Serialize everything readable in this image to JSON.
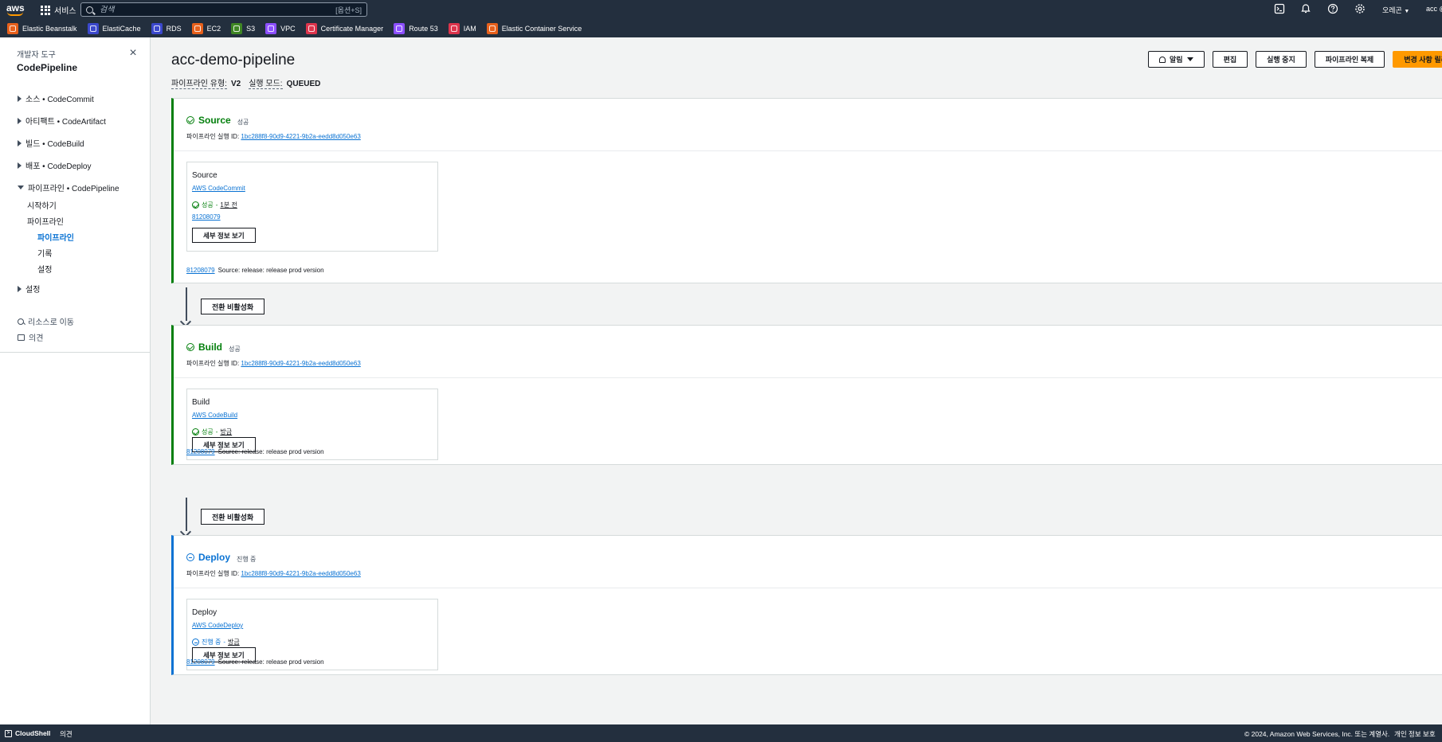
{
  "topnav": {
    "logo": "aws",
    "services": "서비스",
    "search_placeholder": "검색",
    "search_shortcut": "[옵션+S]",
    "region": "오레곤",
    "account": "acc @",
    "icons": [
      "cloudshell-icon",
      "bell-icon",
      "help-icon",
      "gear-icon"
    ]
  },
  "favorites": [
    {
      "label": "Elastic Beanstalk",
      "color": "#e7601b"
    },
    {
      "label": "ElastiCache",
      "color": "#3b48cc"
    },
    {
      "label": "RDS",
      "color": "#3b48cc"
    },
    {
      "label": "EC2",
      "color": "#e7601b"
    },
    {
      "label": "S3",
      "color": "#3f8624"
    },
    {
      "label": "VPC",
      "color": "#8c4fff"
    },
    {
      "label": "Certificate Manager",
      "color": "#dd344c"
    },
    {
      "label": "Route 53",
      "color": "#8c4fff"
    },
    {
      "label": "IAM",
      "color": "#dd344c"
    },
    {
      "label": "Elastic Container Service",
      "color": "#e7601b"
    }
  ],
  "sidebar": {
    "devtools": "개발자 도구",
    "title": "CodePipeline",
    "groups": [
      {
        "label": "소스 • CodeCommit",
        "expanded": false
      },
      {
        "label": "아티팩트 • CodeArtifact",
        "expanded": false
      },
      {
        "label": "빌드 • CodeBuild",
        "expanded": false
      },
      {
        "label": "배포 • CodeDeploy",
        "expanded": false
      },
      {
        "label": "파이프라인 • CodePipeline",
        "expanded": true
      }
    ],
    "pipeline_items": {
      "getting_started": "시작하기",
      "pipelines": "파이프라인",
      "pipeline_active": "파이프라인",
      "history": "기록",
      "settings_sub": "설정"
    },
    "settings": "설정",
    "go_to_resource": "리소스로 이동",
    "feedback": "의견"
  },
  "page": {
    "title": "acc-demo-pipeline",
    "type_label": "파이프라인 유형:",
    "type_value": "V2",
    "mode_label": "실행 모드:",
    "mode_value": "QUEUED"
  },
  "actions": {
    "notify": "알림",
    "edit": "편집",
    "stop": "실행 중지",
    "clone": "파이프라인 복제",
    "release": "변경 사항 릴리스"
  },
  "exec_label": "파이프라인 실행 ID:",
  "transition_label": "전환 비활성화",
  "details_label": "세부 정보 보기",
  "stages": [
    {
      "name": "Source",
      "status": "성공",
      "exec_id": "1bc288f8-90d9-4221-9b2a-eedd8d050e63",
      "action_name": "Source",
      "provider": "AWS CodeCommit",
      "action_status": "성공",
      "time": "1분 전",
      "commit": "81208079",
      "foot_commit": "81208079",
      "foot_msg": "Source: release: release prod version"
    },
    {
      "name": "Build",
      "status": "성공",
      "exec_id": "1bc288f8-90d9-4221-9b2a-eedd8d050e63",
      "action_name": "Build",
      "provider": "AWS CodeBuild",
      "action_status": "성공",
      "time": "방금",
      "foot_commit": "81208079",
      "foot_msg": "Source: release: release prod version"
    },
    {
      "name": "Deploy",
      "status": "진행 중",
      "exec_id": "1bc288f8-90d9-4221-9b2a-eedd8d050e63",
      "action_name": "Deploy",
      "provider": "AWS CodeDeploy",
      "action_status": "진행 중",
      "time": "방금",
      "foot_commit": "81208079",
      "foot_msg": "Source: release: release prod version"
    }
  ],
  "footer": {
    "cloudshell": "CloudShell",
    "feedback": "의견",
    "copyright": "© 2024, Amazon Web Services, Inc. 또는 계열사.",
    "privacy": "개인 정보 보호"
  },
  "colors": {
    "nav_bg": "#232f3e",
    "success": "#037f0c",
    "in_progress": "#0972d3",
    "primary_button": "#ff9900"
  }
}
